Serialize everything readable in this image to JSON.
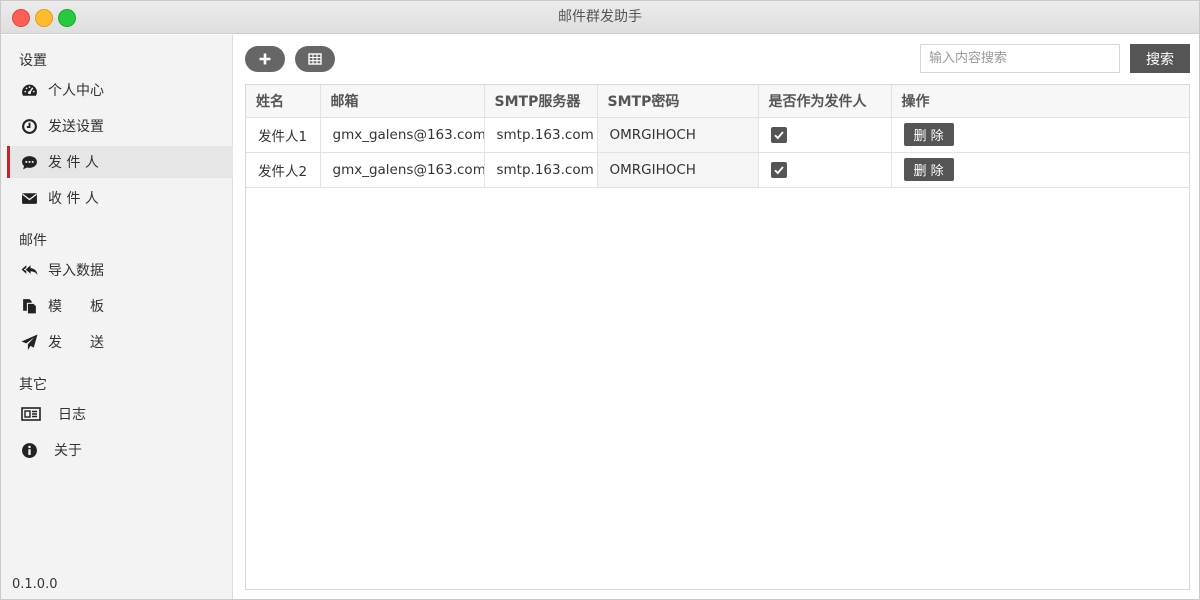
{
  "window": {
    "title": "邮件群发助手"
  },
  "sidebar": {
    "sections": [
      {
        "title": "设置",
        "items": [
          {
            "label": "个人中心",
            "icon": "dashboard-icon"
          },
          {
            "label": "发送设置",
            "icon": "clock-icon"
          },
          {
            "label": "发 件 人",
            "icon": "comment-icon",
            "active": true
          },
          {
            "label": "收 件 人",
            "icon": "envelope-icon"
          }
        ]
      },
      {
        "title": "邮件",
        "items": [
          {
            "label": "导入数据",
            "icon": "reply-all-icon"
          },
          {
            "label": "模　　板",
            "icon": "copy-icon"
          },
          {
            "label": "发　　送",
            "icon": "paper-plane-icon"
          }
        ]
      },
      {
        "title": "其它",
        "items": [
          {
            "label": "日志",
            "icon": "newspaper-icon"
          },
          {
            "label": "关于",
            "icon": "info-circle-icon"
          }
        ]
      }
    ],
    "version": "0.1.0.0"
  },
  "toolbar": {
    "add_icon": "plus-icon",
    "table_icon": "table-icon",
    "search_placeholder": "输入内容搜索",
    "search_label": "搜索"
  },
  "table": {
    "columns": [
      "姓名",
      "邮箱",
      "SMTP服务器",
      "SMTP密码",
      "是否作为发件人",
      "操作"
    ],
    "rows": [
      {
        "name": "发件人1",
        "email": "gmx_galens@163.com",
        "smtp": "smtp.163.com",
        "password": "OMRGIHOCH",
        "is_sender": true,
        "action": "删 除"
      },
      {
        "name": "发件人2",
        "email": "gmx_galens@163.com",
        "smtp": "smtp.163.com",
        "password": "OMRGIHOCH",
        "is_sender": true,
        "action": "删 除"
      }
    ]
  },
  "colors": {
    "accent": "#c1272d",
    "button": "#555555"
  }
}
